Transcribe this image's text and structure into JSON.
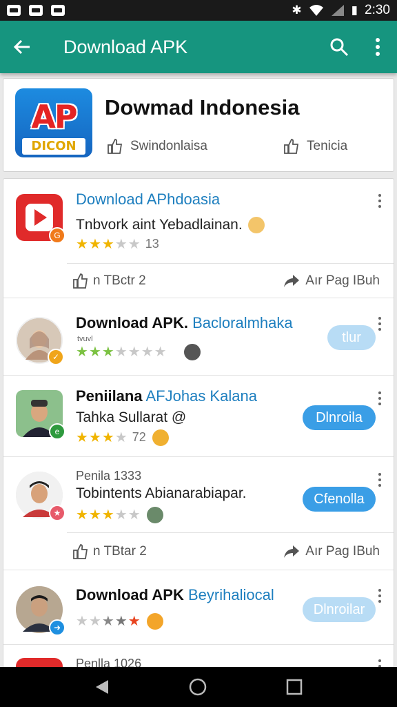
{
  "status_bar": {
    "time": "2:30",
    "battery": "▮"
  },
  "app_bar": {
    "title": "Download APK",
    "back_icon": "arrow-left-icon",
    "search_icon": "search-icon",
    "more_icon": "more-vert-icon"
  },
  "header": {
    "logo_text": "AP",
    "logo_sub": "DICON",
    "title": "Dowmad Indonesia",
    "meta_left": "Swindonlaisa",
    "meta_right": "Tenicia"
  },
  "items": [
    {
      "title_bold": "",
      "title_blue": "Download APhdoasia",
      "subtitle": "Tnbvork aint Yebadlainan.",
      "rating_text": "13",
      "stars": [
        1,
        1,
        1,
        0.5,
        0
      ]
    },
    {
      "action_left": "n TBctr 2",
      "action_right": "Aır Pag IBuh"
    },
    {
      "title_bold": "Download APK.",
      "title_blue": "Bacloralmhaka",
      "subtitle": "",
      "small": "tvuvl",
      "install": "tlur",
      "stars": [
        1,
        1,
        1,
        0,
        0,
        0,
        0
      ]
    },
    {
      "title_bold": "Peniilana",
      "title_blue": "AFJohas Kalana",
      "subtitle": "Tahka Sullarat @",
      "rating_text": "72",
      "install": "Dlnroila",
      "stars": [
        1,
        1,
        1,
        0.5,
        0
      ]
    },
    {
      "title_plain": "Penila 1333",
      "subtitle": "Tobintents Abianarabiapar.",
      "install": "Cfenolla",
      "stars": [
        1,
        1,
        1,
        0.5,
        0
      ]
    },
    {
      "action_left": "n TBtar 2",
      "action_right": "Aır Pag IBuh"
    },
    {
      "title_bold": "Download APK",
      "title_blue": "Beyrihaliocal",
      "install": "Dlnroilar",
      "stars": [
        0,
        0,
        1,
        1,
        1
      ]
    },
    {
      "title_plain": "Penlla 1026"
    }
  ],
  "colors": {
    "accent": "#16957f",
    "link": "#1e7fbf",
    "button": "#3a9ee6",
    "star": "#f0b400"
  }
}
